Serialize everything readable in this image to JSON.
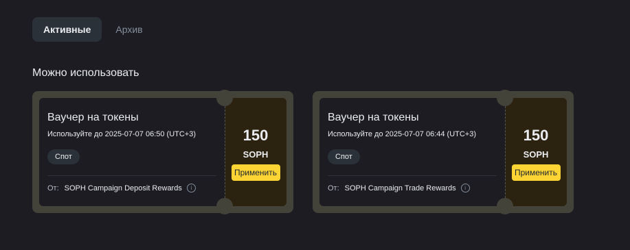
{
  "tabs": [
    {
      "label": "Активные",
      "active": true
    },
    {
      "label": "Архив",
      "active": false
    }
  ],
  "section_title": "Можно использовать",
  "vouchers": [
    {
      "title": "Ваучер на токены",
      "expiry": "Используйте до 2025-07-07 06:50 (UTC+3)",
      "badge": "Спот",
      "from_label": "От:",
      "from_source": "SOPH Campaign Deposit Rewards",
      "amount": "150",
      "token": "SOPH",
      "apply_label": "Применить"
    },
    {
      "title": "Ваучер на токены",
      "expiry": "Используйте до 2025-07-07 06:44 (UTC+3)",
      "badge": "Спот",
      "from_label": "От:",
      "from_source": "SOPH Campaign Trade Rewards",
      "amount": "150",
      "token": "SOPH",
      "apply_label": "Применить"
    }
  ],
  "info_icon": "ⓘ",
  "colors": {
    "background": "#1c1c22",
    "accent": "#fcd535",
    "card_frame": "#43433a",
    "reward_panel": "#2b2210"
  }
}
